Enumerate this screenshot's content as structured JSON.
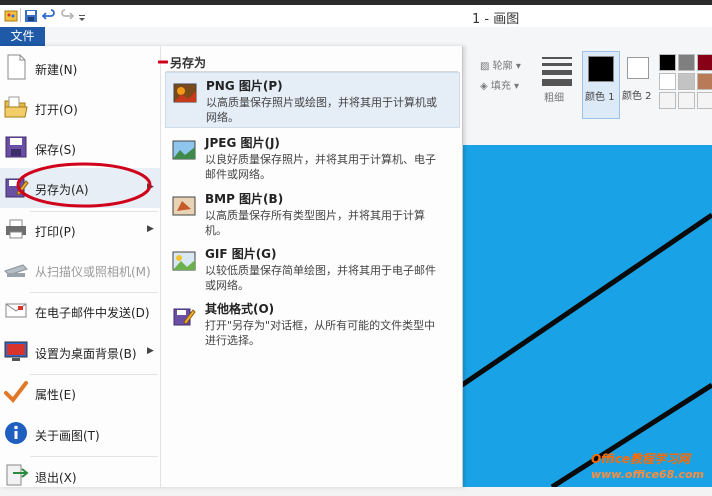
{
  "window": {
    "title": "1 - 画图"
  },
  "ribbon": {
    "file_tab": "文件",
    "outline_label": "轮廓",
    "fill_label": "填充",
    "size_label": "粗细",
    "color1_label": "颜色 1",
    "color2_label": "颜色 2",
    "palette": [
      "#000000",
      "#7f7f7f",
      "#880015",
      "#ed1c24",
      "#ffffff",
      "#c3c3c3",
      "#b97a57",
      "#ffaec9"
    ]
  },
  "file_menu": {
    "items": [
      {
        "label": "新建(N)",
        "icon": "new-document-icon"
      },
      {
        "label": "打开(O)",
        "icon": "open-folder-icon"
      },
      {
        "label": "保存(S)",
        "icon": "save-disk-icon"
      },
      {
        "label": "另存为(A)",
        "icon": "save-as-icon"
      },
      {
        "label": "打印(P)",
        "icon": "printer-icon"
      },
      {
        "label": "从扫描仪或照相机(M)",
        "icon": "scanner-icon"
      },
      {
        "label": "在电子邮件中发送(D)",
        "icon": "email-icon"
      },
      {
        "label": "设置为桌面背景(B)",
        "icon": "desktop-background-icon"
      },
      {
        "label": "属性(E)",
        "icon": "properties-check-icon"
      },
      {
        "label": "关于画图(T)",
        "icon": "info-icon"
      },
      {
        "label": "退出(X)",
        "icon": "exit-icon"
      }
    ]
  },
  "save_as_panel": {
    "title": "另存为",
    "options": [
      {
        "title": "PNG 图片(P)",
        "desc": "以高质量保存照片或绘图，并将其用于计算机或网络。",
        "icon": "png-image-icon"
      },
      {
        "title": "JPEG 图片(J)",
        "desc": "以良好质量保存照片，并将其用于计算机、电子邮件或网络。",
        "icon": "jpeg-image-icon"
      },
      {
        "title": "BMP 图片(B)",
        "desc": "以高质量保存所有类型图片，并将其用于计算机。",
        "icon": "bmp-image-icon"
      },
      {
        "title": "GIF 图片(G)",
        "desc": "以较低质量保存简单绘图，并将其用于电子邮件或网络。",
        "icon": "gif-image-icon"
      },
      {
        "title": "其他格式(O)",
        "desc": "打开\"另存为\"对话框，从所有可能的文件类型中进行选择。",
        "icon": "other-formats-icon"
      }
    ]
  },
  "watermark": {
    "brand": "Office教程学习网",
    "url": "www.office68.com"
  },
  "colors": {
    "accent": "#1e5aa8",
    "canvas_blue": "#1aa6e8",
    "highlight_red": "#d0021b"
  }
}
